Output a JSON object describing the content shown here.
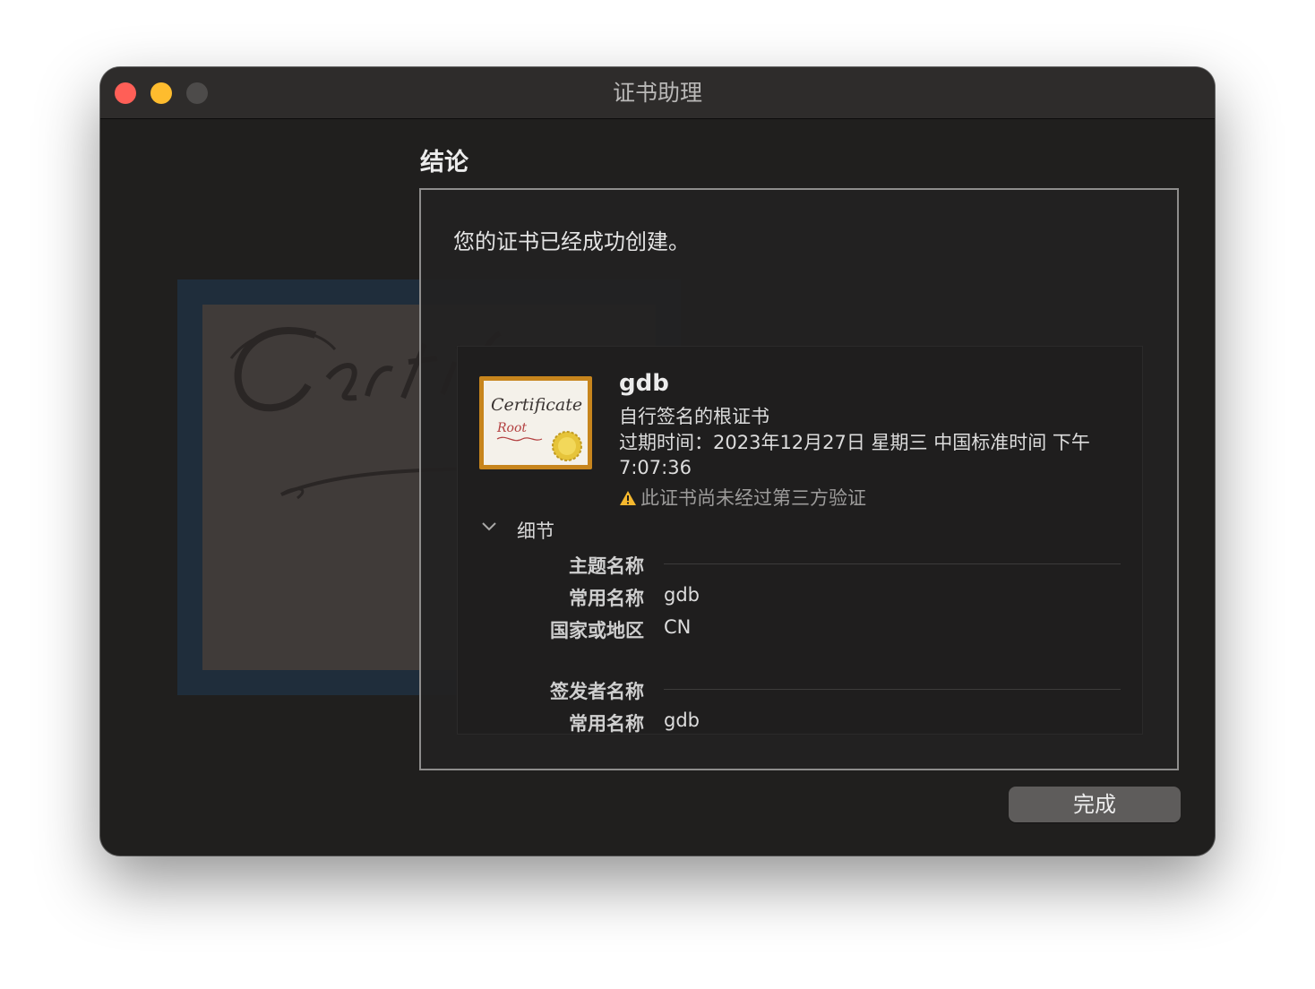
{
  "window": {
    "title": "证书助理"
  },
  "section": {
    "heading": "结论"
  },
  "panel": {
    "message": "您的证书已经成功创建。"
  },
  "certificate": {
    "icon_text_main": "Certificate",
    "icon_text_sub": "Root",
    "name": "gdb",
    "type": "自行签名的根证书",
    "expiry": "过期时间：2023年12月27日 星期三 中国标准时间 下午7:07:36",
    "warning": "此证书尚未经过第三方验证"
  },
  "details": {
    "label": "细节",
    "subject_heading": "主题名称",
    "subject_rows": [
      {
        "label": "常用名称",
        "value": "gdb"
      },
      {
        "label": "国家或地区",
        "value": "CN"
      }
    ],
    "issuer_heading": "签发者名称",
    "issuer_rows": [
      {
        "label": "常用名称",
        "value": "gdb"
      }
    ]
  },
  "footer": {
    "done_label": "完成"
  },
  "colors": {
    "close": "#ff5f57",
    "minimize": "#febc2e",
    "zoom_disabled": "#4d4b4a",
    "warning": "#f5b82e",
    "cert_frame": "#c7851d",
    "seal": "#e6c43a"
  },
  "icons": [
    "close-button",
    "minimize-button",
    "zoom-button",
    "chevron-down-icon",
    "warning-icon",
    "certificate-icon",
    "seal-icon"
  ]
}
